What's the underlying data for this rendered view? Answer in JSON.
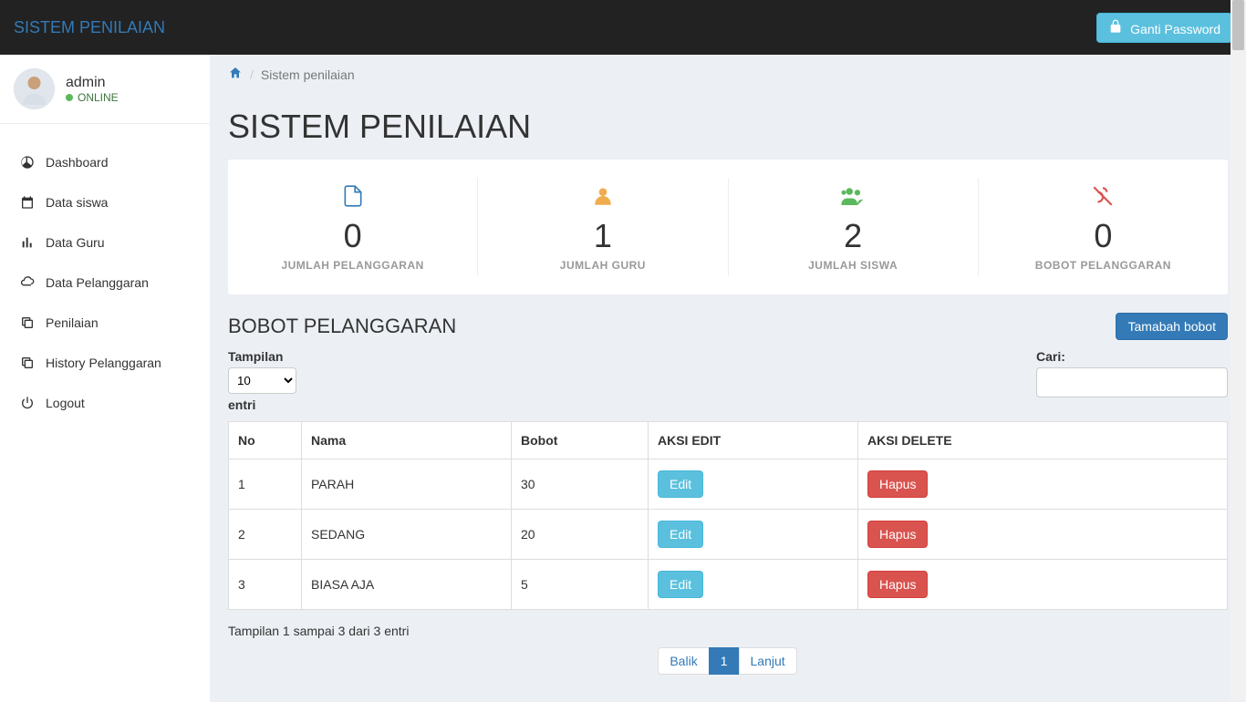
{
  "navbar": {
    "brand": "SISTEM PENILAIAN",
    "password_btn": "Ganti Password"
  },
  "user": {
    "name": "admin",
    "status": "ONLINE"
  },
  "sidebar": {
    "items": [
      {
        "label": "Dashboard"
      },
      {
        "label": "Data siswa"
      },
      {
        "label": "Data Guru"
      },
      {
        "label": "Data Pelanggaran"
      },
      {
        "label": "Penilaian"
      },
      {
        "label": "History Pelanggaran"
      },
      {
        "label": "Logout"
      }
    ]
  },
  "breadcrumb": {
    "current": "Sistem penilaian"
  },
  "page": {
    "title": "SISTEM PENILAIAN"
  },
  "stats": [
    {
      "value": "0",
      "label": "JUMLAH PELANGGARAN",
      "color": "#337ab7"
    },
    {
      "value": "1",
      "label": "JUMLAH GURU",
      "color": "#f0ad4e"
    },
    {
      "value": "2",
      "label": "JUMLAH SISWA",
      "color": "#5cb85c"
    },
    {
      "value": "0",
      "label": "BOBOT PELANGGARAN",
      "color": "#d9534f"
    }
  ],
  "section": {
    "title": "BOBOT PELANGGARAN",
    "add_btn": "Tamabah bobot"
  },
  "table": {
    "length_label_top": "Tampilan",
    "length_value": "10",
    "length_label_bottom": "entri",
    "search_label": "Cari:",
    "search_value": "",
    "headers": [
      "No",
      "Nama",
      "Bobot",
      "AKSI EDIT",
      "AKSI DELETE"
    ],
    "rows": [
      {
        "no": "1",
        "nama": "PARAH",
        "bobot": "30"
      },
      {
        "no": "2",
        "nama": "SEDANG",
        "bobot": "20"
      },
      {
        "no": "3",
        "nama": "BIASA AJA",
        "bobot": "5"
      }
    ],
    "edit_btn": "Edit",
    "delete_btn": "Hapus",
    "info": "Tampilan 1 sampai 3 dari 3 entri",
    "prev": "Balik",
    "page": "1",
    "next": "Lanjut"
  }
}
